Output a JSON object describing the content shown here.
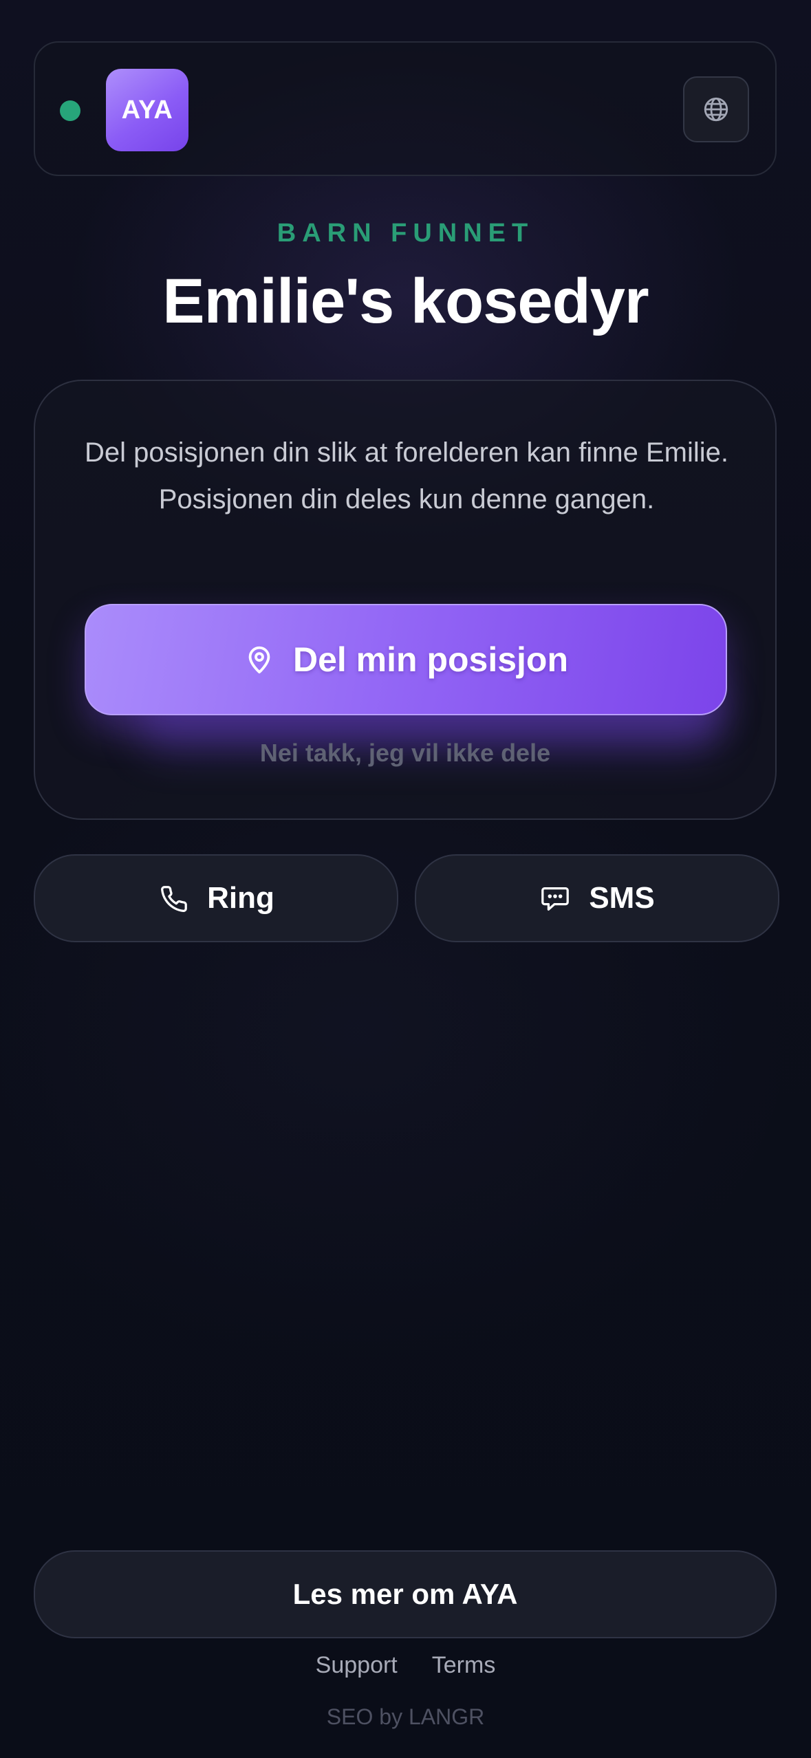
{
  "header": {
    "logo_text": "AYA",
    "status_color": "#27a57a",
    "language_icon": "globe-icon"
  },
  "hero": {
    "eyebrow": "BARN FUNNET",
    "title": "Emilie's kosedyr"
  },
  "location_card": {
    "message": "Del posisjonen din slik at forelderen kan finne Emilie. Posisjonen din deles kun denne gangen.",
    "share_icon": "map-pin-icon",
    "share_label": "Del min posisjon",
    "decline_label": "Nei takk, jeg vil ikke dele"
  },
  "contact": {
    "call_icon": "phone-icon",
    "call_label": "Ring",
    "sms_icon": "chat-bubble-icon",
    "sms_label": "SMS"
  },
  "footer": {
    "about_label": "Les mer om AYA",
    "support_label": "Support",
    "terms_label": "Terms",
    "credit": "SEO by LANGR"
  },
  "colors": {
    "accent_purple": "#8b5cf6",
    "accent_green": "#2a9d76",
    "background": "#0c0e1a"
  }
}
